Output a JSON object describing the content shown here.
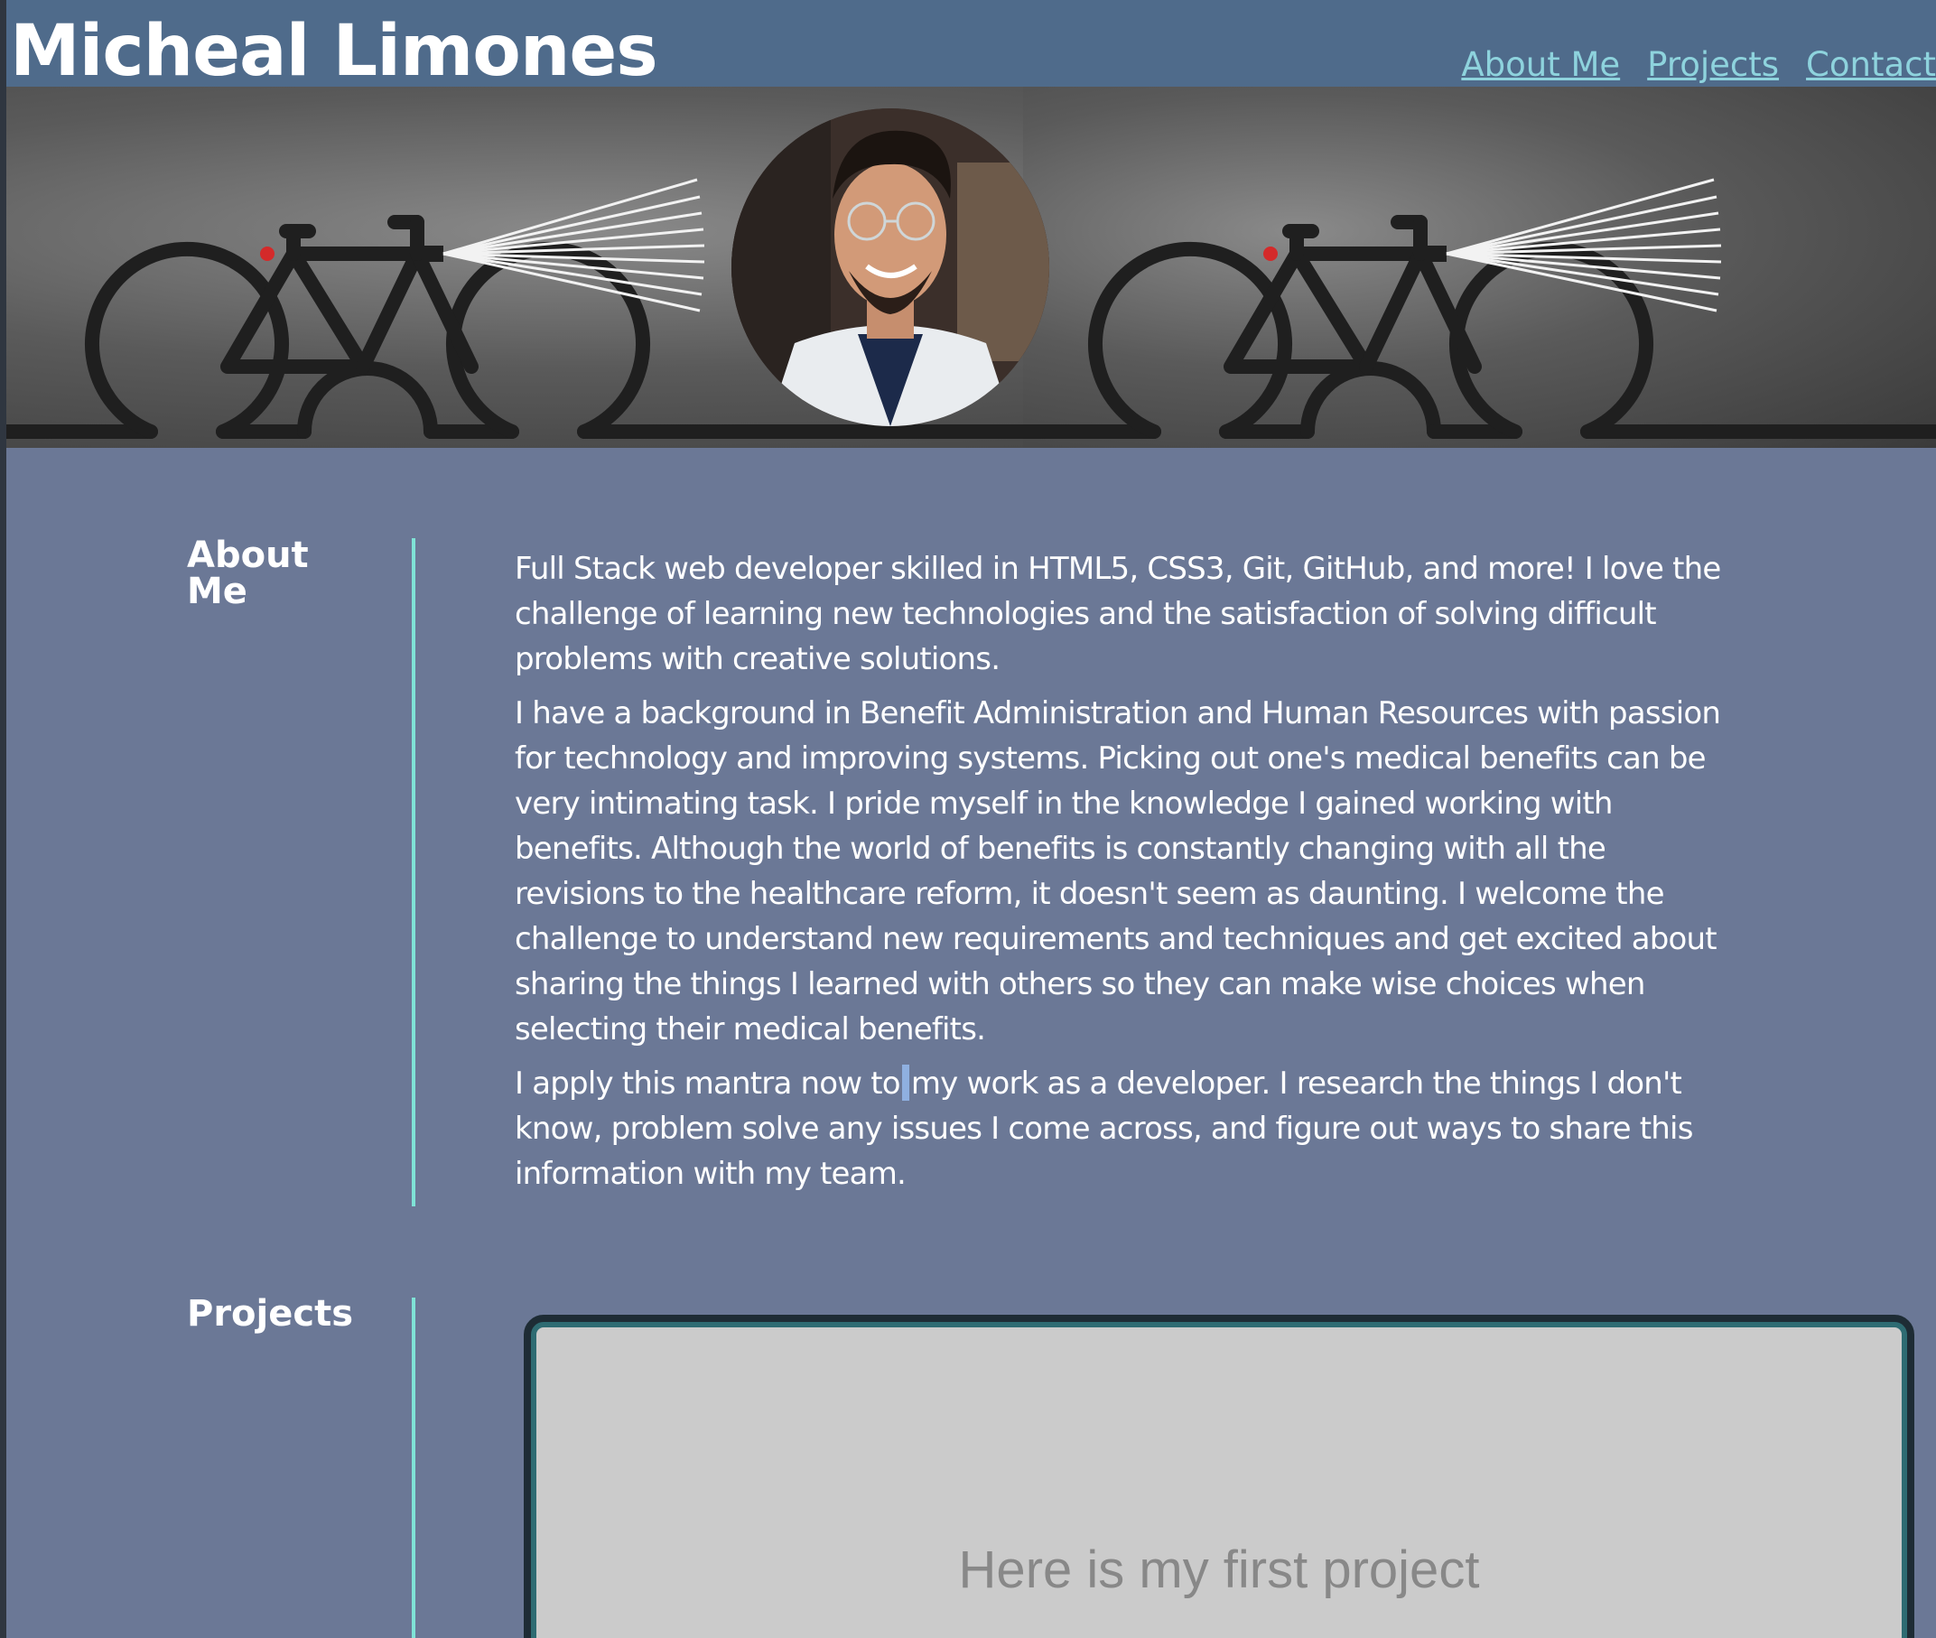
{
  "header": {
    "title": "Micheal Limones",
    "nav": [
      "About Me",
      "Projects",
      "Contact"
    ]
  },
  "hero": {
    "left_image": "bike-with-headlight-illustration",
    "avatar": "profile-photo",
    "right_image": "bike-with-headlight-illustration"
  },
  "about": {
    "label": "About Me",
    "paragraphs": [
      "Full Stack web developer skilled in HTML5, CSS3, Git, GitHub, and more! I love the challenge of learning new technologies and the satisfaction of solving difficult problems with creative solutions.",
      "I have a background in Benefit Administration and Human Resources with passion for technology and improving systems. Picking out one's medical benefits can be very intimating task. I pride myself in the knowledge I gained working with benefits. Although the world of benefits is constantly changing with all the revisions to the healthcare reform, it doesn't seem as daunting. I welcome the challenge to understand new requirements and techniques and get excited about sharing the things I learned with others so they can make wise choices when selecting their medical benefits.",
      "I apply this mantra now to",
      "my work as a developer. I research the things I don't know, problem solve any issues I come across, and figure out ways to share this information with my team."
    ]
  },
  "projects": {
    "label": "Projects",
    "first_caption": "Here is my first project"
  },
  "colors": {
    "header_bg": "#4f6b8b",
    "page_bg": "#6b7896",
    "nav_link": "#8ed3dd",
    "divider": "#7fe3d6"
  }
}
